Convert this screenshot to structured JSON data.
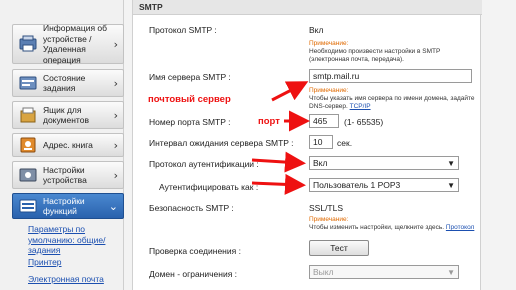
{
  "nav": {
    "items": [
      {
        "label": "Информация об устройстве / Удаленная операция",
        "icon": "device-info-icon"
      },
      {
        "label": "Состояние задания",
        "icon": "job-status-icon"
      },
      {
        "label": "Ящик для документов",
        "icon": "document-box-icon"
      },
      {
        "label": "Адрес. книга",
        "icon": "address-book-icon"
      },
      {
        "label": "Настройки устройства",
        "icon": "device-settings-icon"
      },
      {
        "label": "Настройки функций",
        "icon": "function-settings-icon"
      }
    ],
    "subitems": [
      {
        "label": "Параметры по умолчанию: общие/задания"
      },
      {
        "label": "Принтер"
      },
      {
        "label": "Электронная почта"
      }
    ]
  },
  "panel": {
    "section_title": "SMTP",
    "protocol": {
      "label": "Протокол SMTP :",
      "value": "Вкл"
    },
    "note1": {
      "title": "Примечание:",
      "text": "Необходимо произвести настройки в SMTP (электронная почта, передача)."
    },
    "server": {
      "label": "Имя сервера SMTP :",
      "value": "smtp.mail.ru"
    },
    "note2": {
      "title": "Примечание:",
      "text": "Чтобы указать имя сервера по имени домена, задайте DNS-сервер.",
      "link": "TCP/IP"
    },
    "port": {
      "label": "Номер порта SMTP :",
      "value": "465",
      "range": "(1- 65535)"
    },
    "timeout": {
      "label": "Интервал ожидания сервера SMTP :",
      "value": "10",
      "unit": "сек."
    },
    "auth_protocol": {
      "label": "Протокол аутентификации :",
      "value": "Вкл"
    },
    "auth_as": {
      "label": "Аутентифицировать как :",
      "value": "Пользователь 1 POP3"
    },
    "security": {
      "label": "Безопасность SMTP :",
      "value": "SSL/TLS"
    },
    "note3": {
      "title": "Примечание:",
      "text": "Чтобы изменить настройки, щелкните здесь.",
      "link": "Протокол"
    },
    "connection_test": {
      "label": "Проверка соединения :",
      "button": "Тест"
    },
    "domain_restriction": {
      "label": "Домен - ограничения :",
      "value": "Выкл"
    }
  },
  "annotations": {
    "server_label": "почтовый сервер",
    "port_label": "порт",
    "color": "#ee1111"
  }
}
